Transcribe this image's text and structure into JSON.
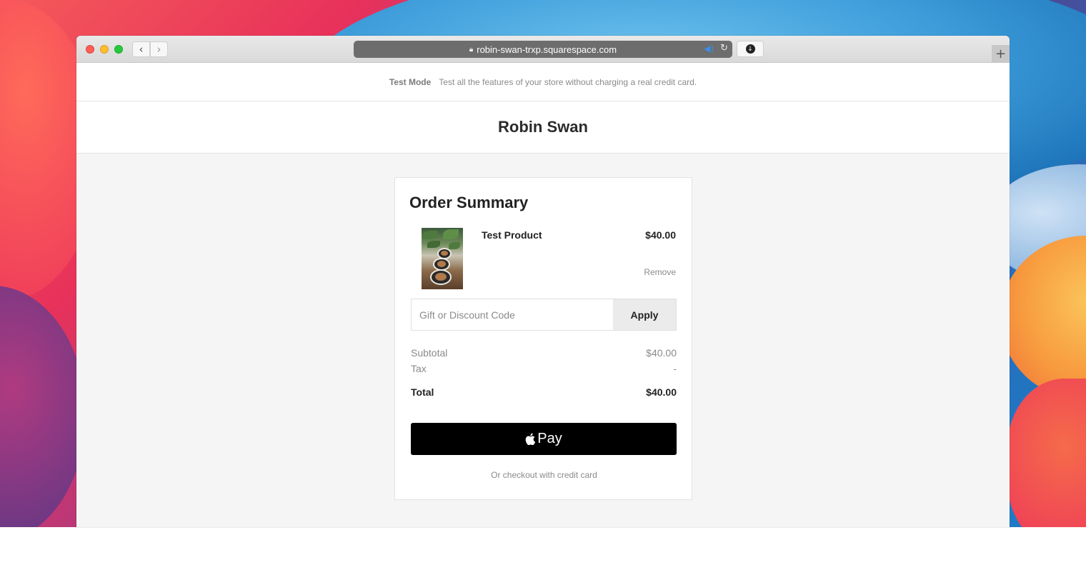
{
  "browser": {
    "url": "robin-swan-trxp.squarespace.com",
    "back_symbol": "‹",
    "forward_symbol": "›",
    "new_tab_symbol": "+",
    "icons": [
      "lock-icon",
      "audio-icon",
      "reload-icon",
      "download-icon",
      "new-tab-icon"
    ]
  },
  "test_banner": {
    "label": "Test Mode",
    "message": "Test all the features of your store without charging a real credit card."
  },
  "store": {
    "name": "Robin Swan"
  },
  "order_summary": {
    "title": "Order Summary",
    "item": {
      "name": "Test Product",
      "price": "$40.00",
      "remove_label": "Remove"
    },
    "discount": {
      "placeholder": "Gift or Discount Code",
      "apply_label": "Apply"
    },
    "subtotal": {
      "label": "Subtotal",
      "value": "$40.00"
    },
    "tax": {
      "label": "Tax",
      "value": "-"
    },
    "total": {
      "label": "Total",
      "value": "$40.00"
    },
    "apple_pay_label": "Pay",
    "credit_card_link": "Or checkout with credit card"
  },
  "colors": {
    "apple_pay_bg": "#000000",
    "apply_bg": "#ebebeb",
    "page_bg": "#f5f5f5",
    "traffic_red": "#fe5f57",
    "traffic_yellow": "#febc2e",
    "traffic_green": "#28c840"
  }
}
